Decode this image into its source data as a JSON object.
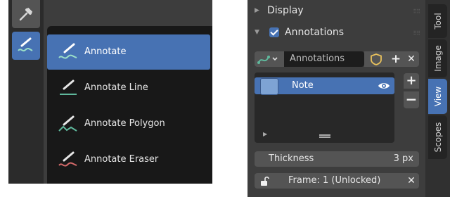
{
  "tool_menu": {
    "items": [
      {
        "label": "Annotate",
        "icon": "annotate-icon",
        "active": true
      },
      {
        "label": "Annotate Line",
        "icon": "annotate-line-icon",
        "active": false
      },
      {
        "label": "Annotate Polygon",
        "icon": "annotate-polygon-icon",
        "active": false
      },
      {
        "label": "Annotate Eraser",
        "icon": "annotate-eraser-icon",
        "active": false
      }
    ]
  },
  "toolbar": {
    "tools": [
      "eyedropper-icon",
      "annotate-icon"
    ]
  },
  "sidebar": {
    "panels": {
      "display": {
        "title": "Display",
        "expanded": false
      },
      "annotations": {
        "title": "Annotations",
        "expanded": true,
        "checked": true
      }
    },
    "layer_header": {
      "data_name": "Annotations",
      "buttons": {
        "add": "+",
        "remove": "✕"
      }
    },
    "layers": [
      {
        "name": "Note",
        "color": "#7ea3d4",
        "visible": true
      }
    ],
    "list_buttons": {
      "add": "+",
      "remove": "−"
    },
    "thickness": {
      "label": "Thickness",
      "value": "3 px"
    },
    "frame": {
      "label": "Frame: 1 (Unlocked)",
      "clear": "✕"
    }
  },
  "tabs": [
    {
      "label": "Tool",
      "active": false
    },
    {
      "label": "Image",
      "active": false
    },
    {
      "label": "View",
      "active": true
    },
    {
      "label": "Scopes",
      "active": false
    }
  ],
  "colors": {
    "accent": "#4772b3",
    "panel": "#3d3d3d",
    "menu": "#181818",
    "annotate_green": "#5fb89c",
    "eraser_red": "#d46a6a",
    "shield_yellow": "#e8c15c"
  }
}
